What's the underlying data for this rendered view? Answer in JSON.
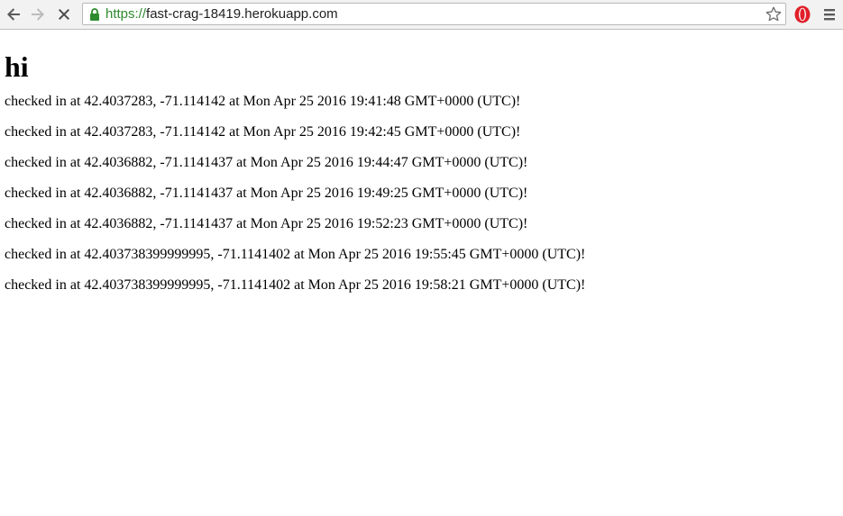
{
  "browser": {
    "url_scheme": "https://",
    "url_host": "fast-crag-18419.herokuapp.com",
    "back_icon": "back-arrow-icon",
    "forward_icon": "forward-arrow-icon",
    "stop_icon": "stop-icon",
    "lock_icon": "lock-icon",
    "bookmark_icon": "star-icon",
    "extension_icon": "opera-extension-icon",
    "menu_icon": "hamburger-menu-icon",
    "colors": {
      "secure_green": "#2e8b2e",
      "extension_red": "#e0202a"
    }
  },
  "page": {
    "heading": "hi",
    "checkins": [
      "checked in at 42.4037283, -71.114142 at Mon Apr 25 2016 19:41:48 GMT+0000 (UTC)!",
      "checked in at 42.4037283, -71.114142 at Mon Apr 25 2016 19:42:45 GMT+0000 (UTC)!",
      "checked in at 42.4036882, -71.1141437 at Mon Apr 25 2016 19:44:47 GMT+0000 (UTC)!",
      "checked in at 42.4036882, -71.1141437 at Mon Apr 25 2016 19:49:25 GMT+0000 (UTC)!",
      "checked in at 42.4036882, -71.1141437 at Mon Apr 25 2016 19:52:23 GMT+0000 (UTC)!",
      "checked in at 42.403738399999995, -71.1141402 at Mon Apr 25 2016 19:55:45 GMT+0000 (UTC)!",
      "checked in at 42.403738399999995, -71.1141402 at Mon Apr 25 2016 19:58:21 GMT+0000 (UTC)!"
    ]
  }
}
